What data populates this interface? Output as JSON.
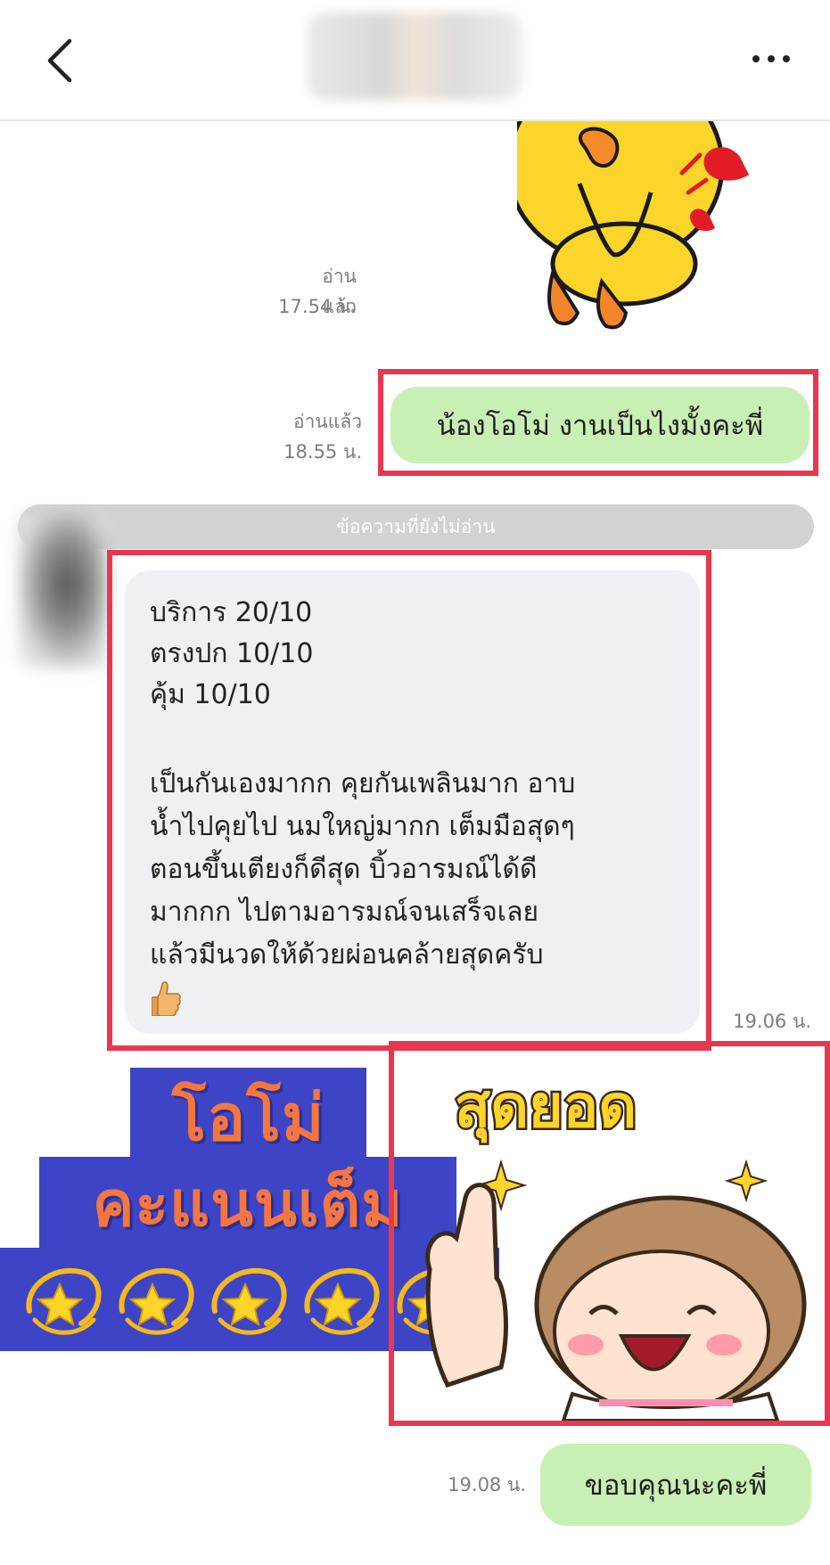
{
  "header": {
    "back_icon": "chevron-left-icon",
    "more_icon": "more-dots-icon"
  },
  "messages": {
    "sticker1": {
      "read_label": "อ่านแล้ว",
      "time": "17.54 น.",
      "sticker": "brown-sally-duck-heart-sticker"
    },
    "outgoing1": {
      "read_label": "อ่านแล้ว",
      "time": "18.55 น.",
      "text": "น้องโอโม่ งานเป็นไงมั้งคะพี่"
    },
    "unread_divider": "ข้อความที่ยังไม่อ่าน",
    "incoming1": {
      "lines": [
        "บริการ 20/10",
        "ตรงปก 10/10",
        "คุ้ม 10/10",
        "",
        "เป็นกันเองมากก คุยกันเพลินมาก อาบ",
        "น้ำไปคุยไป นมใหญ่มากก เต็มมือสุดๆ",
        "ตอนขึ้นเตียงก็ดีสุด บิ้วอารมณ์ได้ดี",
        "มากกก ไปตามอารมณ์จนเสร็จเลย",
        "แล้วมีนวดให้ด้วยผ่อนคล้ายสุดครับ"
      ],
      "emoji": "thumbs-up-icon",
      "time": "19.06 น."
    },
    "sticker2": {
      "caption": "สุดยอด",
      "sticker": "thumbs-up-girl-sticker"
    },
    "outgoing2": {
      "time": "19.08 น.",
      "text": "ขอบคุณนะคะพี่"
    }
  },
  "banner": {
    "line1": "โอโม่",
    "line2": "คะแนนเต็ม",
    "stars": 5,
    "star_icon": "dizzy-star-icon"
  },
  "colors": {
    "outgoing_bubble": "#c9f0b4",
    "incoming_bubble": "#eff0f3",
    "highlight": "#e8384f",
    "banner_bg": "#3d44c6",
    "banner_text": "#f57640"
  }
}
